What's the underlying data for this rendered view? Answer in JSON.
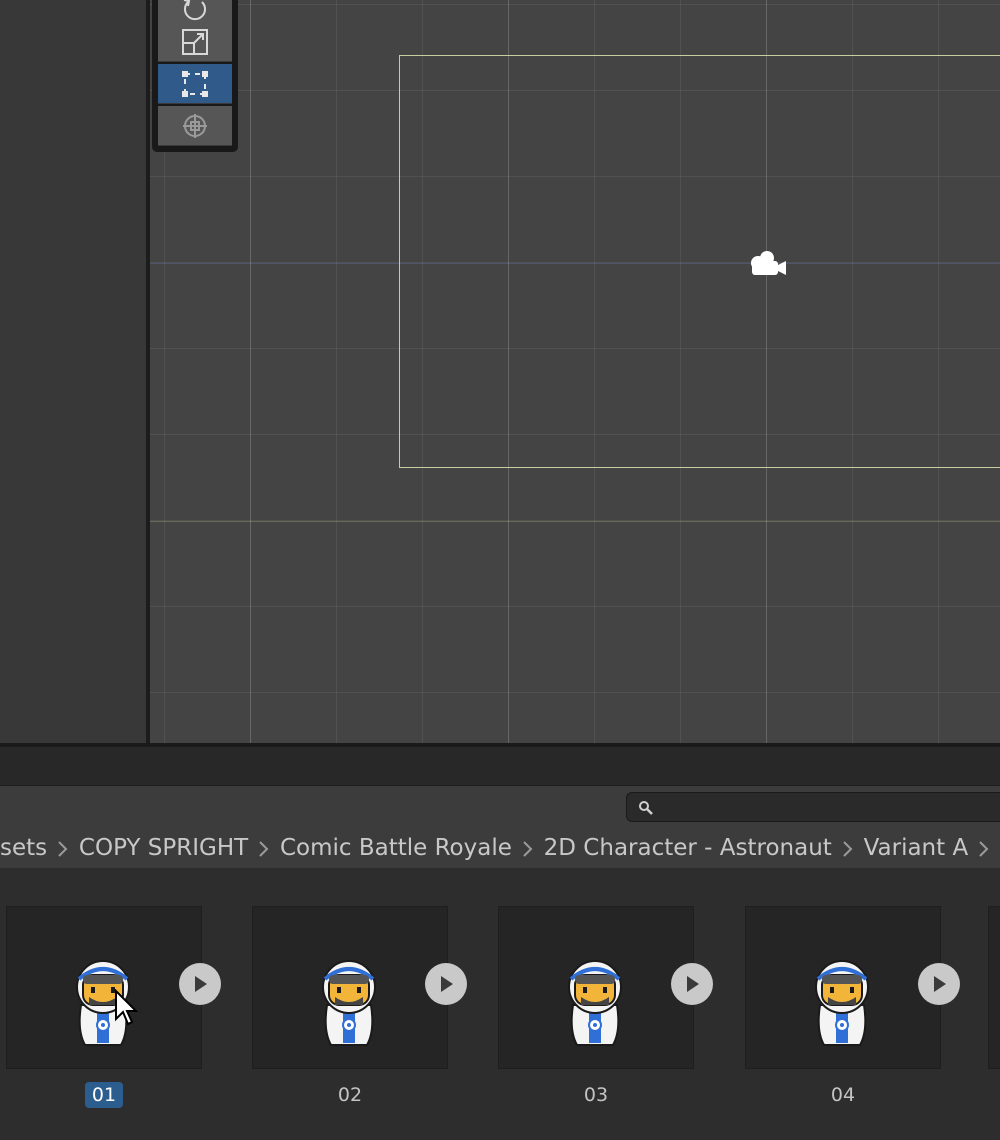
{
  "toolbar": {
    "tools": [
      {
        "name": "rotate-tool",
        "active": false
      },
      {
        "name": "scale-tool",
        "active": false
      },
      {
        "name": "rect-tool",
        "active": true
      },
      {
        "name": "transform-tool",
        "active": false
      }
    ]
  },
  "search": {
    "placeholder": ""
  },
  "breadcrumb": {
    "items": [
      "sets",
      "COPY SPRIGHT",
      "Comic Battle Royale",
      "2D Character - Astronaut",
      "Variant A"
    ]
  },
  "assets": [
    {
      "label": "01",
      "selected": true
    },
    {
      "label": "02",
      "selected": false
    },
    {
      "label": "03",
      "selected": false
    },
    {
      "label": "04",
      "selected": false
    }
  ],
  "colors": {
    "accent": "#2c5d8f",
    "scene_bg": "#444444",
    "camera_frame": "#c8cc9e"
  }
}
